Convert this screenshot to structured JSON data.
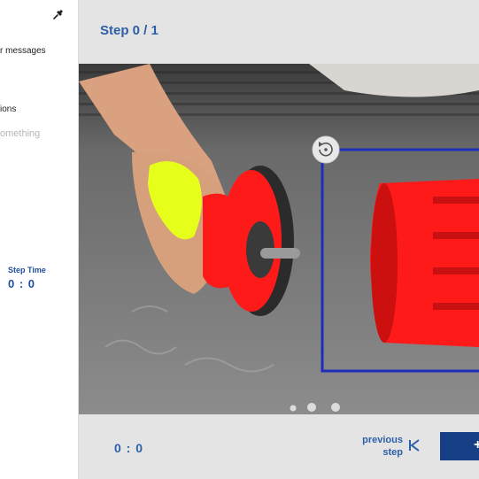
{
  "left_panel": {
    "messages_text": "r messages",
    "options_text": "ions",
    "something_text": "omething",
    "step_time_label": "Step Time",
    "step_time_value": "0 : 0"
  },
  "header": {
    "step_title": "Step 0 / 1"
  },
  "footer": {
    "elapsed_time": "0 : 0",
    "previous_step_line1": "previous",
    "previous_step_line2": "step",
    "next_symbol": "+"
  },
  "icons": {
    "pin": "pin-icon",
    "reset": "reset-view-icon",
    "previous": "skip-previous-icon"
  },
  "colors": {
    "accent": "#2d5fa8",
    "button_dark": "#173f86",
    "highlight_red": "#ff1a1a",
    "highlight_yellow": "#e6ff1a",
    "bounding_box": "#1d2fb8"
  }
}
